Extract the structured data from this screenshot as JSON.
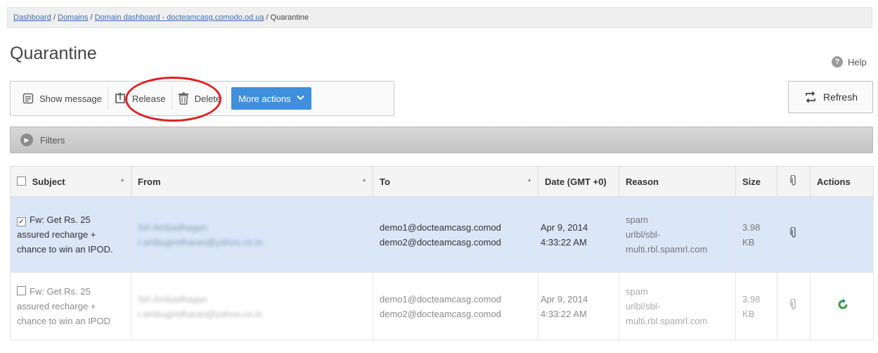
{
  "breadcrumb": {
    "items": [
      "Dashboard",
      "Domains",
      "Domain dashboard - docteamcasg.comodo.od.ua"
    ],
    "current": "Quarantine",
    "separator": " / "
  },
  "page": {
    "title": "Quarantine",
    "help_label": "Help"
  },
  "toolbar": {
    "show_message": "Show message",
    "release": "Release",
    "delete": "Delete",
    "more_actions": "More actions",
    "refresh": "Refresh"
  },
  "filters": {
    "label": "Filters"
  },
  "table": {
    "headers": {
      "subject": "Subject",
      "from": "From",
      "to": "To",
      "date": "Date (GMT +0)",
      "reason": "Reason",
      "size": "Size",
      "actions": "Actions"
    },
    "rows": [
      {
        "selected": true,
        "subject": "Fw: Get Rs. 25 assured recharge + chance to win an IPOD.",
        "from_name": "Siri Ambadhagan",
        "from_email": "r.ambugiridharan@yahoo.co.in",
        "to": [
          "demo1@docteamcasg.comod",
          "demo2@docteamcasg.comod"
        ],
        "date": [
          "Apr 9, 2014",
          "4:33:22 AM"
        ],
        "reason": [
          "spam",
          "urlbl/sbl-",
          "multi.rbl.spamrl.com"
        ],
        "size": [
          "3.98",
          "KB"
        ]
      },
      {
        "selected": false,
        "subject": "Fw: Get Rs. 25 assured recharge + chance to win an IPOD",
        "from_name": "Siri Ambadhagan",
        "from_email": "r.ambugiridharan@yahoo.co.in",
        "to": [
          "demo1@docteamcasg.comod",
          "demo2@docteamcasg.comod"
        ],
        "date": [
          "Apr 9, 2014",
          "4:33:22 AM"
        ],
        "reason": [
          "spam",
          "urlbl/sbl-",
          "multi.rbl.spamrl.com"
        ],
        "size": [
          "3.98",
          "KB"
        ]
      }
    ]
  },
  "icons": {
    "show_message": "message-icon",
    "release": "release-icon",
    "delete": "trash-icon",
    "refresh": "refresh-icon",
    "help": "help-icon",
    "filters": "expand-arrow-icon",
    "attachment": "paperclip-icon",
    "restore": "restore-icon"
  },
  "colors": {
    "accent": "#3f8fdd",
    "selected_row": "#dbe6f7",
    "annotation": "#e02020",
    "link": "#3a6fb5"
  }
}
